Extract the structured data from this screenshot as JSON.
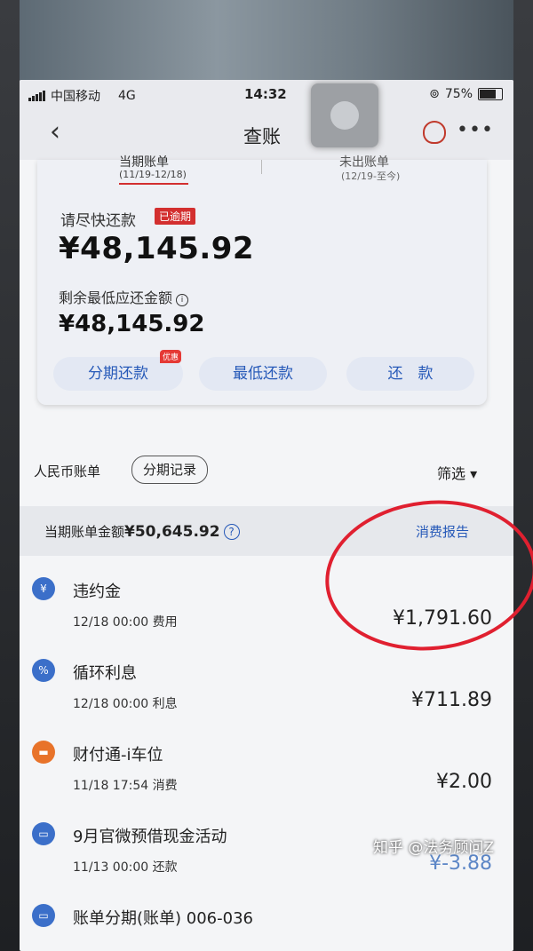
{
  "status": {
    "carrier": "中国移动",
    "network": "4G",
    "time": "14:32",
    "battery": "75%"
  },
  "nav": {
    "back": "‹",
    "title": "查账",
    "more": "•••"
  },
  "tabs": [
    {
      "label": "当期账单",
      "range": "(11/19-12/18)"
    },
    {
      "label": "未出账单",
      "range": "(12/19-至今)"
    }
  ],
  "summary": {
    "repay_prompt": "请尽快还款",
    "overdue_badge": "已逾期",
    "amount_due": "¥48,145.92",
    "min_label": "剩余最低应还金额",
    "min_amount": "¥48,145.92"
  },
  "actions": {
    "installment": "分期还款",
    "promo": "优惠",
    "minimum": "最低还款",
    "repay": "还　款"
  },
  "section": {
    "currency": "人民币账单",
    "installment_record": "分期记录",
    "filter": "筛选 ▾"
  },
  "statement": {
    "label": "当期账单金额",
    "amount": "¥50,645.92",
    "report": "消费报告"
  },
  "transactions": [
    {
      "name": "违约金",
      "date": "12/18 00:00 费用",
      "amount": "¥1,791.60",
      "icon": "¥",
      "color": "#3b6fc9"
    },
    {
      "name": "循环利息",
      "date": "12/18 00:00 利息",
      "amount": "¥711.89",
      "icon": "%",
      "color": "#3b6fc9"
    },
    {
      "name": "财付通-i车位",
      "date": "11/18 17:54 消费",
      "amount": "¥2.00",
      "icon": "▬",
      "color": "#e8732a"
    },
    {
      "name": "9月官微预借现金活动",
      "date": "11/13 00:00 还款",
      "amount": "¥-3.88",
      "icon": "▭",
      "color": "#3b6fc9"
    },
    {
      "name": "账单分期(账单) 006-036",
      "date": "",
      "amount": "",
      "icon": "▭",
      "color": "#3b6fc9"
    }
  ],
  "watermark": "知乎 @法务顾问Z"
}
